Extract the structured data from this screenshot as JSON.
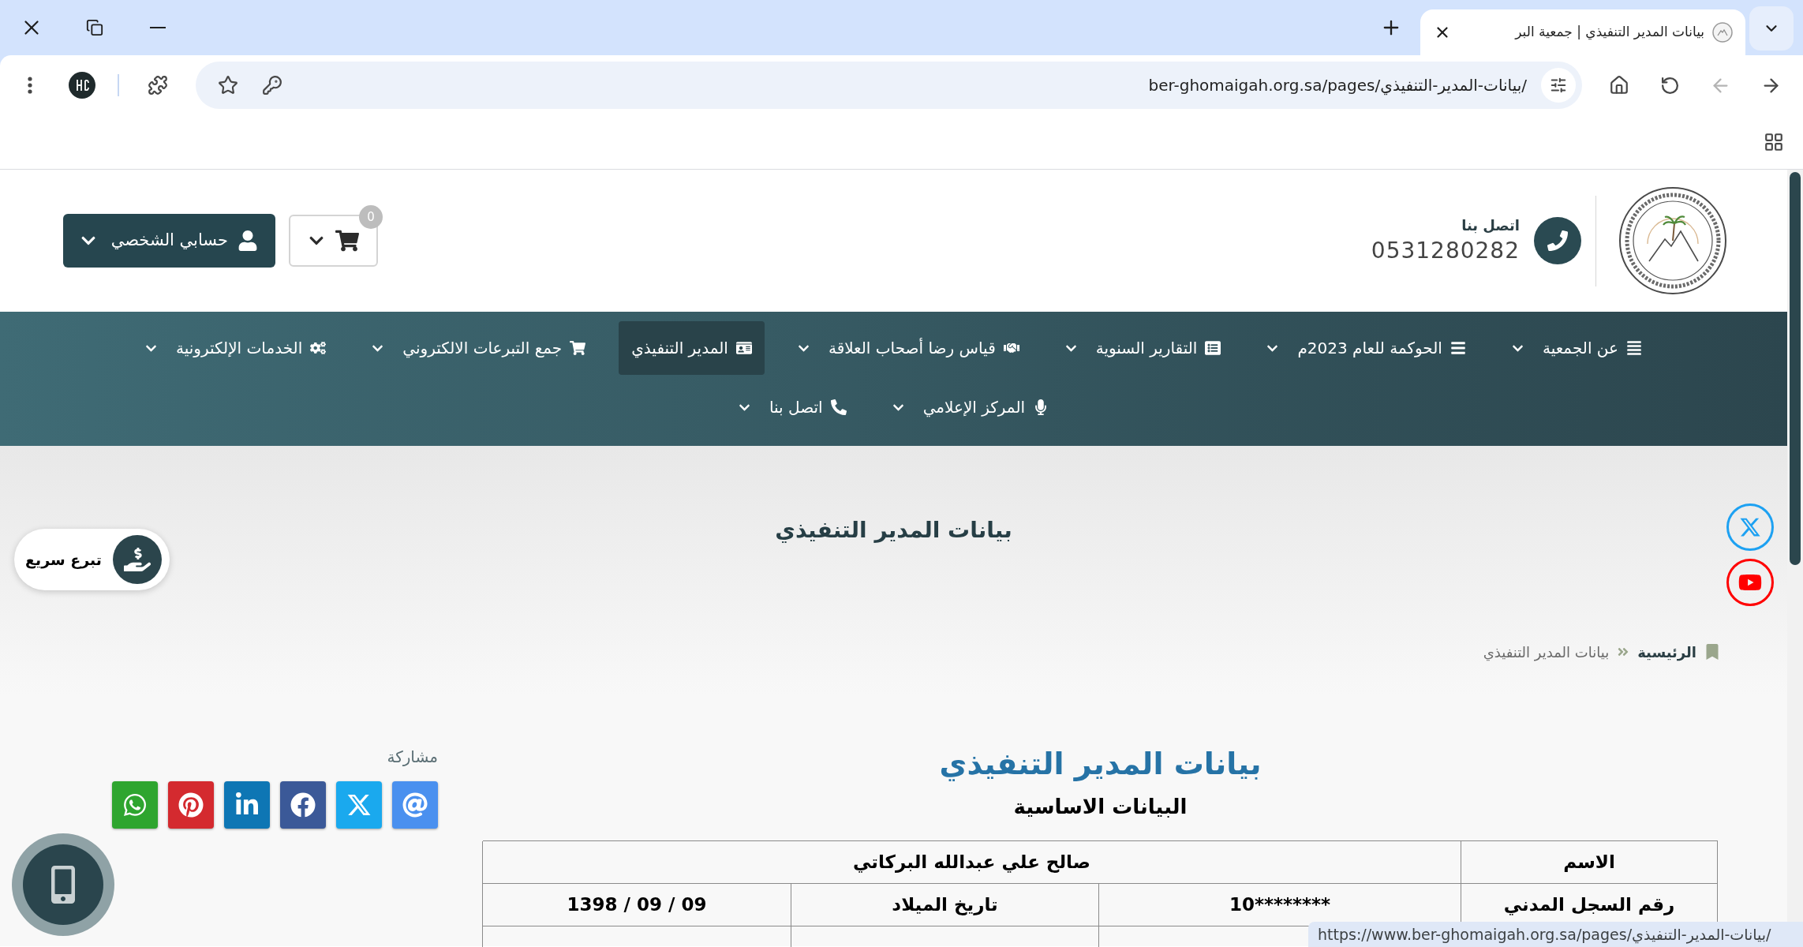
{
  "browser": {
    "tab": {
      "title": "بيانات المدير التنفيذي | جمعية البر"
    },
    "address_bar": {
      "url": "ber-ghomaigah.org.sa/pages/بيانات-المدير-التنفيذي/"
    },
    "back": {
      "disabled": false
    },
    "forward": {
      "disabled": true
    },
    "status_url": "https://www.ber-ghomaigah.org.sa/pages/بيانات-المدير-التنفيذي/"
  },
  "header": {
    "contact": {
      "label": "اتصل بنا",
      "phone": "0531280282"
    },
    "cart": {
      "count": "0"
    },
    "account_button": "حسابي الشخصي"
  },
  "nav": {
    "rows": [
      {
        "items": [
          {
            "label": "عن الجمعية",
            "selected": false,
            "dropdown": true
          },
          {
            "label": "الحوكمة للعام 2023م",
            "selected": false,
            "dropdown": true
          },
          {
            "label": "التقارير السنوية",
            "selected": false,
            "dropdown": true
          },
          {
            "label": "قياس رضا أصحاب العلاقة",
            "selected": false,
            "dropdown": true
          },
          {
            "label": "المدير التنفيذي",
            "selected": true,
            "dropdown": false
          },
          {
            "label": "جمع التبرعات الالكتروني",
            "selected": false,
            "dropdown": true
          },
          {
            "label": "الخدمات الإلكترونية",
            "selected": false,
            "dropdown": true
          }
        ]
      },
      {
        "items": [
          {
            "label": "المركز الإعلامي",
            "selected": false,
            "dropdown": true
          },
          {
            "label": "اتصل بنا",
            "selected": false,
            "dropdown": true
          }
        ]
      }
    ]
  },
  "hero": {
    "title": "بيانات المدير التنفيذي",
    "breadcrumb": [
      {
        "label": "الرئيسية",
        "current": false
      },
      {
        "label": "بيانات المدير التنفيذي",
        "current": true
      }
    ]
  },
  "quick_donate": {
    "label": "تبرع سريع"
  },
  "share": {
    "label": "مشاركة"
  },
  "content": {
    "title": "بيانات المدير التنفيذي",
    "subtitle": "البيانات الاساسية",
    "table": {
      "name_row": {
        "label": "الاسم",
        "value": "صالح علي عبدالله البركاتي"
      },
      "rows": [
        {
          "cells": [
            "رقم السجل المدني",
            "10********",
            "تاريخ الميلاد",
            "1398 / 09 / 09"
          ]
        }
      ]
    }
  }
}
